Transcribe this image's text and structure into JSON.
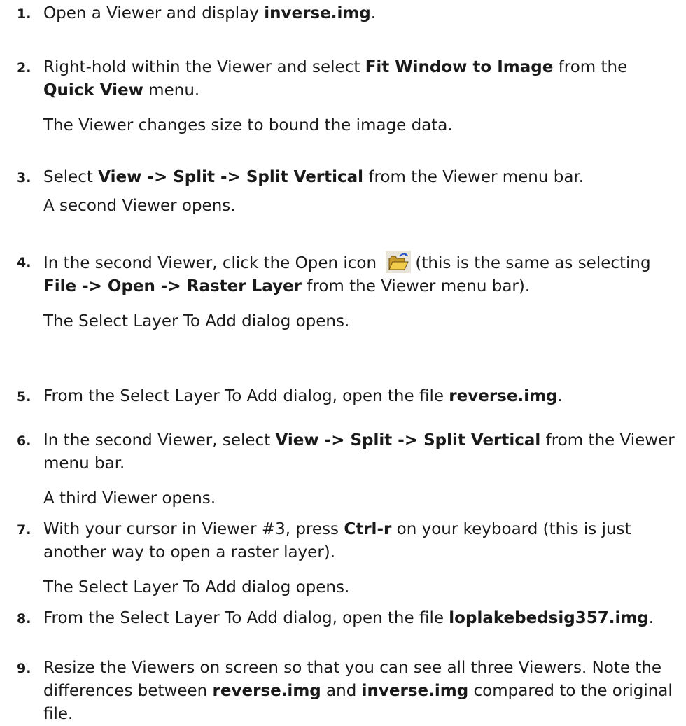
{
  "steps": [
    {
      "number": "1.",
      "parts": [
        "Open a Viewer and display ",
        "inverse.img",
        "."
      ],
      "note": ""
    },
    {
      "number": "2.",
      "parts": [
        "Right-hold within the Viewer and select ",
        "Fit Window to Image",
        " from the ",
        "Quick View",
        " menu."
      ],
      "note": "The Viewer changes size to bound the image data."
    },
    {
      "number": "3.",
      "parts": [
        "Select ",
        "View -> Split -> Split Vertical",
        " from the Viewer menu bar."
      ],
      "note": "A second Viewer opens."
    },
    {
      "number": "4.",
      "parts": [
        "In the second Viewer, click the Open icon ",
        "(this is the same as selecting ",
        "File -> Open -> Raster Layer",
        " from the Viewer menu bar)."
      ],
      "icon": "open-folder-icon",
      "note": "The Select Layer To Add dialog opens."
    },
    {
      "number": "5.",
      "parts": [
        "From the Select Layer To Add dialog, open the file ",
        "reverse.img",
        "."
      ],
      "note": ""
    },
    {
      "number": "6.",
      "parts": [
        "In the second Viewer, select ",
        "View -> Split -> Split Vertical",
        " from the Viewer menu bar."
      ],
      "note": "A third Viewer opens."
    },
    {
      "number": "7.",
      "parts": [
        "With your cursor in Viewer #3, press ",
        "Ctrl-r",
        " on your keyboard (this is just another way to open a raster layer)."
      ],
      "note": "The Select Layer To Add dialog opens."
    },
    {
      "number": "8.",
      "parts": [
        "From the Select Layer To Add dialog, open the file ",
        "loplakebedsig357.img",
        "."
      ],
      "note": ""
    },
    {
      "number": "9.",
      "parts": [
        "Resize the Viewers on screen so that you can see all three Viewers. Note the differences between ",
        "reverse.img",
        " and ",
        "inverse.img",
        " compared to the original file."
      ],
      "note": ""
    }
  ]
}
